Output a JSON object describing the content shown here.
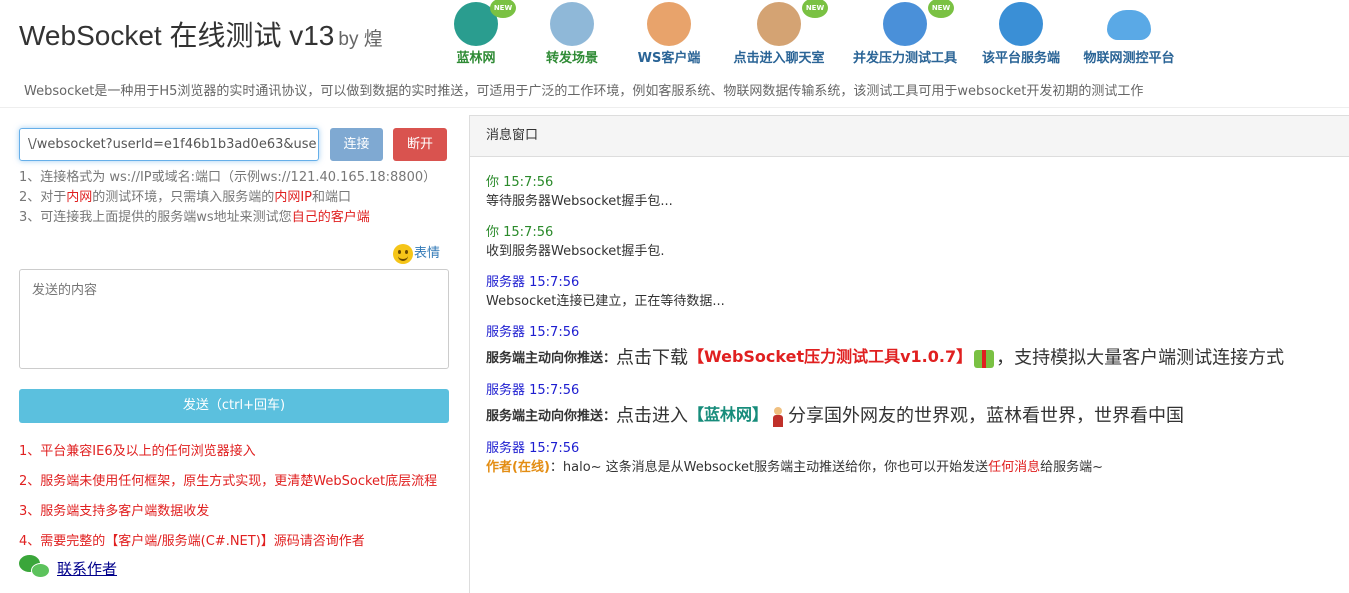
{
  "header": {
    "title": "WebSocket 在线测试 v13",
    "by": "by 煌",
    "description": "Websocket是一种用于H5浏览器的实时通讯协议，可以做到数据的实时推送，可适用于广泛的工作环境，例如客服系统、物联网数据传输系统，该测试工具可用于websocket开发初期的测试工作",
    "nav": [
      {
        "label": "蓝林网",
        "icon": "globe-icon",
        "new": true,
        "color": "#2a9d8f"
      },
      {
        "label": "转发场景",
        "icon": "antenna-icon",
        "new": false,
        "color": "#8fb8d8"
      },
      {
        "label": "WS客户端",
        "icon": "speaker-icon",
        "new": false,
        "color": "#e8a36b"
      },
      {
        "label": "点击进入聊天室",
        "icon": "chat-users-icon",
        "new": true,
        "color": "#d4a373"
      },
      {
        "label": "并发压力测试工具",
        "icon": "pencil-ruler-icon",
        "new": true,
        "color": "#4a90d9"
      },
      {
        "label": "该平台服务端",
        "icon": "earth-icon",
        "new": false,
        "color": "#3a8fd6"
      },
      {
        "label": "物联网测控平台",
        "icon": "cloud-icon",
        "new": false,
        "color": "#5aa9e6"
      }
    ],
    "new_badge": "NEW"
  },
  "connect": {
    "url_value": "\\/websocket?userId=e1f46b1b3ad0e63&use",
    "connect_label": "连接",
    "disconnect_label": "断开",
    "tip1": "1、连接格式为 ws://IP或域名:端口（示例ws://121.40.165.18:8800）",
    "tip2_a": "2、对于",
    "tip2_b": "内网",
    "tip2_c": "的测试环境，只需填入服务端的",
    "tip2_d": "内网IP",
    "tip2_e": "和端口",
    "tip3_a": "3、可连接我上面提供的服务端ws地址来测试您",
    "tip3_b": "自己的客户端"
  },
  "compose": {
    "emoji_label": "表情",
    "placeholder": "发送的内容",
    "send_label": "发送（ctrl+回车)"
  },
  "features": [
    "1、平台兼容IE6及以上的任何浏览器接入",
    "2、服务端未使用任何框架，原生方式实现，更清楚WebSocket底层流程",
    "3、服务端支持多客户端数据收发",
    "4、需要完整的【客户端/服务端(C#.NET)】源码请咨询作者"
  ],
  "contact_label": "联系作者",
  "messages_panel": {
    "title": "消息窗口",
    "messages": [
      {
        "who": "你 15:7:56",
        "body": "等待服务器Websocket握手包..."
      },
      {
        "who": "你 15:7:56",
        "body": "收到服务器Websocket握手包."
      },
      {
        "who": "服务器 15:7:56",
        "body": "Websocket连接已建立，正在等待数据..."
      },
      {
        "who": "服务器 15:7:56",
        "prefix": "服务端主动向你推送：",
        "big_a": "点击下载",
        "highlight": "【WebSocket压力测试工具v1.0.7】",
        "big_b": "，支持模拟大量客户端测试连接方式"
      },
      {
        "who": "服务器 15:7:56",
        "prefix": "服务端主动向你推送：",
        "big_a": "点击进入",
        "highlight": "【蓝林网】",
        "big_b": "分享国外网友的世界观，蓝林看世界，世界看中国"
      },
      {
        "who": "服务器 15:7:56",
        "author": "作者(在线)",
        "body_a": "：halo~ 这条消息是从Websocket服务端主动推送给你，你也可以开始发送",
        "body_red": "任何消息",
        "body_b": "给服务端~"
      }
    ]
  }
}
